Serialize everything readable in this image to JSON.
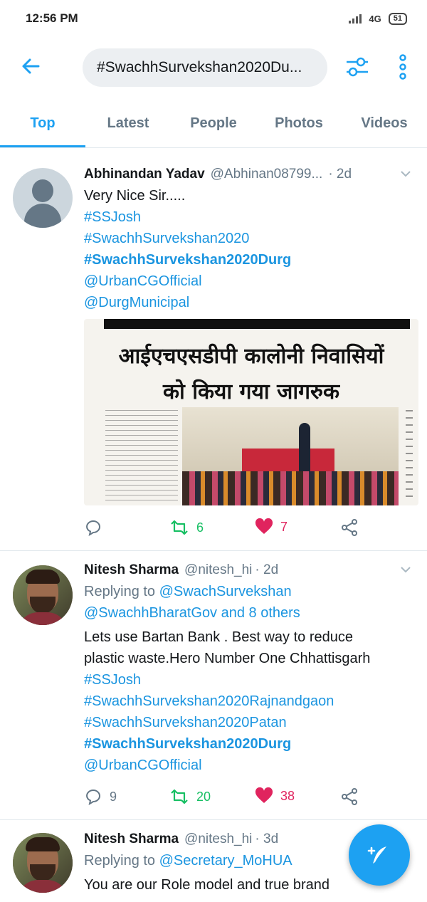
{
  "status_bar": {
    "time": "12:56 PM",
    "network": "4G",
    "battery": "51"
  },
  "top_bar": {
    "search_query": "#SwachhSurvekshan2020Du..."
  },
  "tabs": [
    {
      "label": "Top",
      "active": true
    },
    {
      "label": "Latest",
      "active": false
    },
    {
      "label": "People",
      "active": false
    },
    {
      "label": "Photos",
      "active": false
    },
    {
      "label": "Videos",
      "active": false
    }
  ],
  "tweets": [
    {
      "name": "Abhinandan Yadav",
      "handle": "@Abhinan08799...",
      "time": "· 2d",
      "lines": [
        {
          "text": "Very Nice Sir.....",
          "style": "text"
        },
        {
          "text": "#SSJosh",
          "style": "link"
        },
        {
          "text": "#SwachhSurvekshan2020",
          "style": "link"
        },
        {
          "text": "#SwachhSurvekshan2020Durg",
          "style": "link-strong"
        },
        {
          "text": "@UrbanCGOfficial",
          "style": "link"
        },
        {
          "text": "@DurgMunicipal",
          "style": "link"
        }
      ],
      "media": {
        "headline_1": "आईएचएसडीपी कालोनी निवासियों",
        "headline_2": "को किया गया जागरुक"
      },
      "reply_count": "",
      "retweet_count": "6",
      "like_count": "7"
    },
    {
      "name": "Nitesh Sharma",
      "handle": "@nitesh_hi",
      "time": "· 2d",
      "replying_prefix": "Replying to",
      "replying_to": "@SwachSurvekshan",
      "replying_line2": "@SwachhBharatGov and 8 others",
      "lines": [
        {
          "text": "Lets use  Bartan Bank . Best way to reduce",
          "style": "text"
        },
        {
          "text": "plastic waste.Hero Number One Chhattisgarh",
          "style": "text"
        },
        {
          "text": "#SSJosh",
          "style": "link"
        },
        {
          "text": "#SwachhSurvekshan2020Rajnandgaon",
          "style": "link"
        },
        {
          "text": "#SwachhSurvekshan2020Patan",
          "style": "link"
        },
        {
          "text": "#SwachhSurvekshan2020Durg",
          "style": "link-strong"
        },
        {
          "text": "@UrbanCGOfficial",
          "style": "link"
        }
      ],
      "reply_count": "9",
      "retweet_count": "20",
      "like_count": "38"
    },
    {
      "name": "Nitesh Sharma",
      "handle": "@nitesh_hi",
      "time": "· 3d",
      "replying_prefix": "Replying to",
      "replying_to": "@Secretary_MoHUA",
      "lines": [
        {
          "text": "You are our Role model and true brand",
          "style": "text"
        }
      ]
    }
  ],
  "colors": {
    "accent": "#1da1f2",
    "link": "#1b95e0",
    "retweet": "#17bf63",
    "like": "#e0245e",
    "muted": "#657786"
  },
  "icons": [
    "back-arrow-icon",
    "filter-sliders-icon",
    "more-vertical-icon",
    "chevron-down-icon",
    "reply-icon",
    "retweet-icon",
    "heart-icon",
    "share-icon",
    "compose-tweet-icon",
    "default-avatar-icon"
  ]
}
